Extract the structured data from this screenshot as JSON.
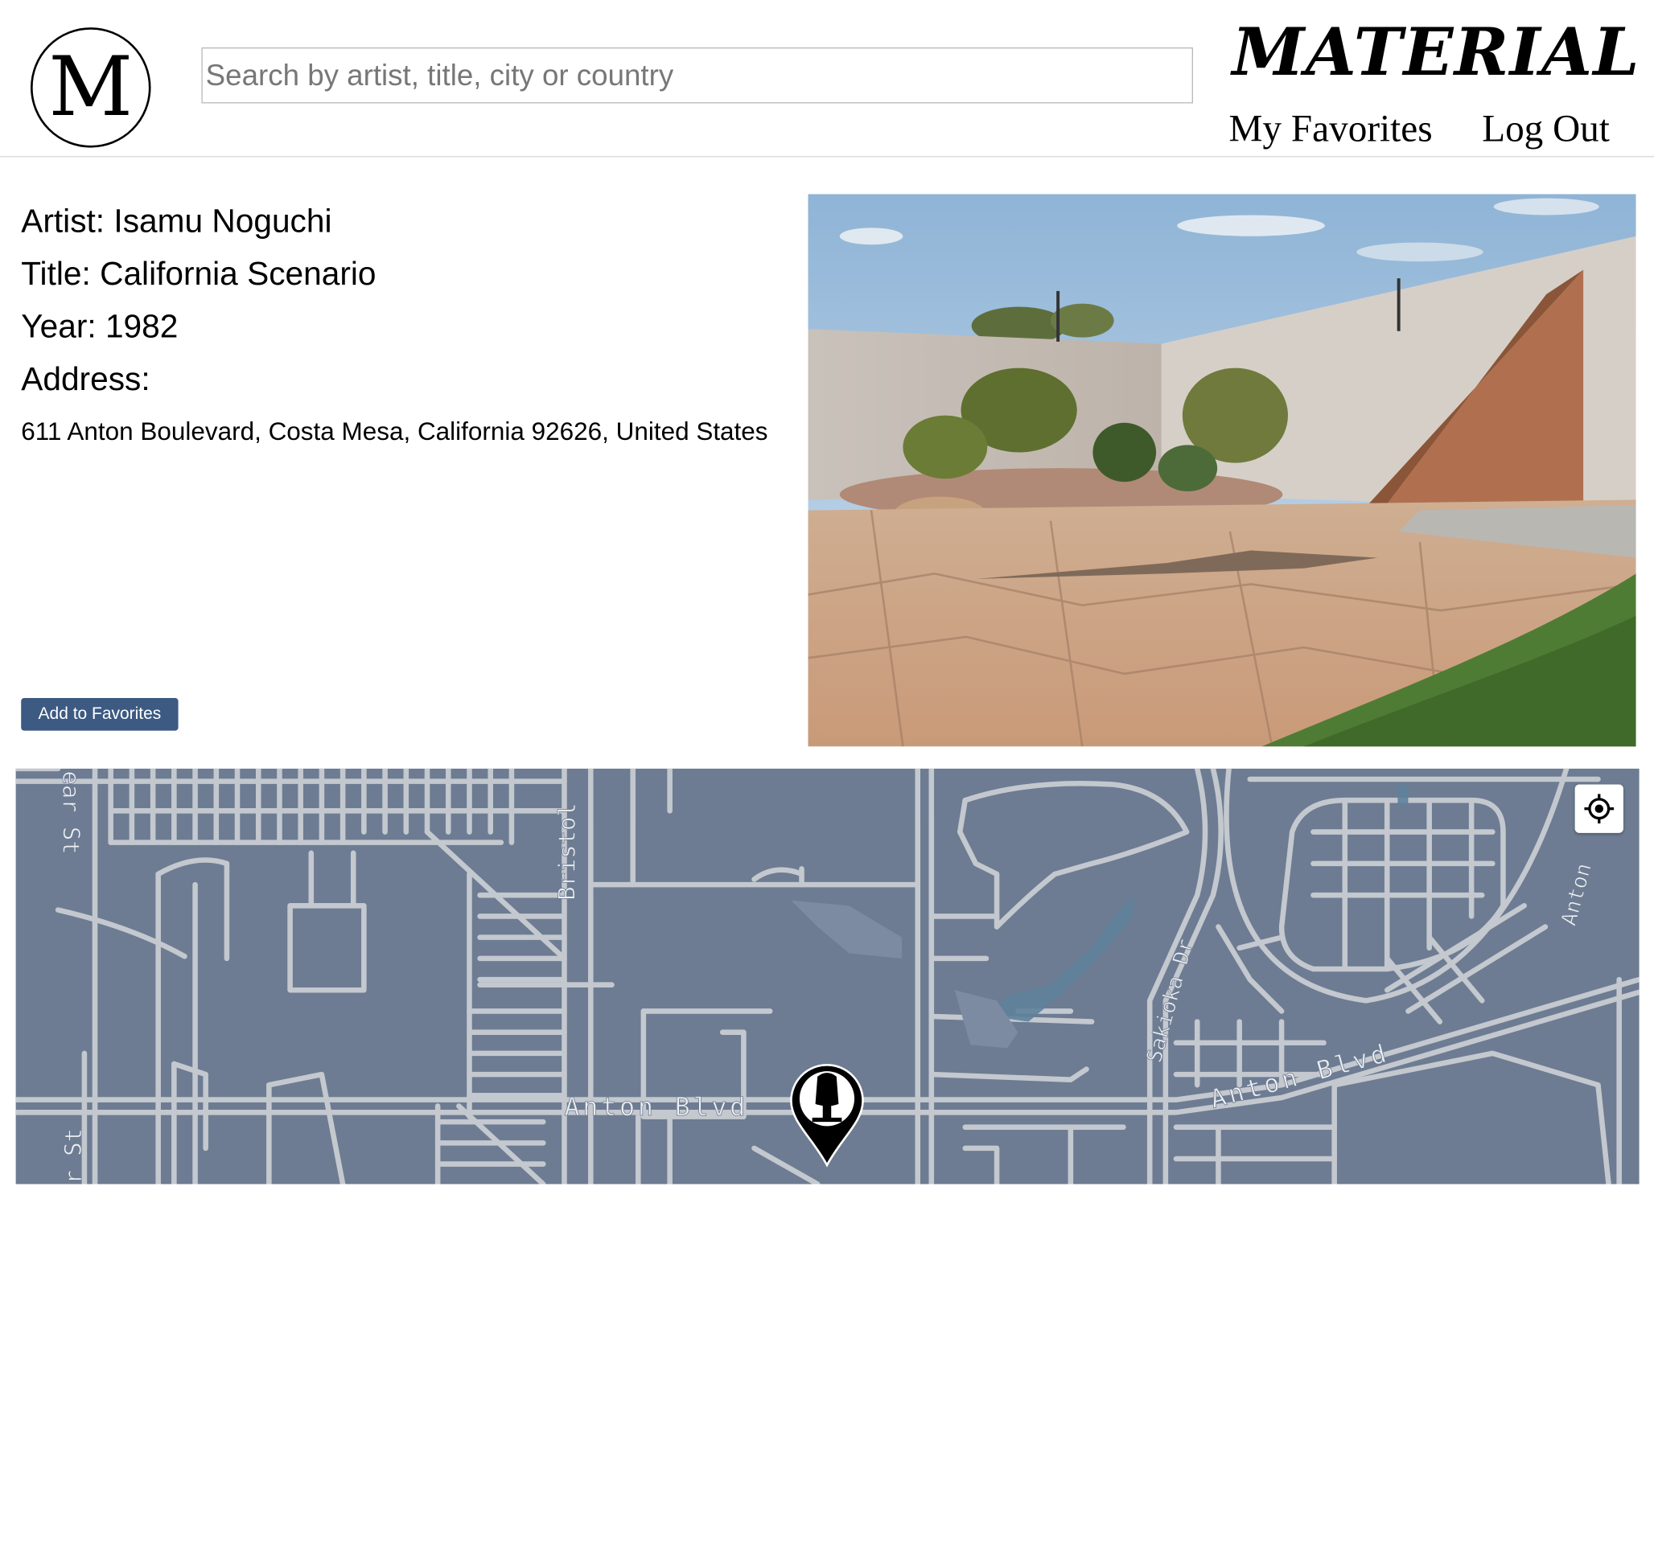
{
  "header": {
    "logo_letter": "M",
    "search_placeholder": "Search by artist, title, city or country",
    "brand": "MATERIAL",
    "nav_favorites": "My Favorites",
    "nav_logout": "Log Out"
  },
  "artwork": {
    "artist_line": "Artist: Isamu Noguchi",
    "title_line": "Title: California Scenario",
    "year_line": "Year: 1982",
    "address_label": "Address:",
    "address": "611 Anton Boulevard, Costa Mesa, California 92626, United States"
  },
  "actions": {
    "add_favorites": "Add to Favorites"
  },
  "map": {
    "labels": {
      "bristol": "Bristol",
      "pear_st": "ear St",
      "harbor_st": "r St",
      "anton_blvd_west": "Anton Blvd",
      "anton_blvd_east": "Anton Blvd",
      "sakioka_dr": "Sakioka Dr",
      "anton_ne": "Anton"
    },
    "colors": {
      "land": "#6d7c92",
      "road": "#c9cdd3",
      "water": "#5b7e93"
    }
  },
  "icons": {
    "logo": "circle-m-logo",
    "locate": "crosshair-locate-icon",
    "marker": "sculpture-map-pin-icon"
  }
}
